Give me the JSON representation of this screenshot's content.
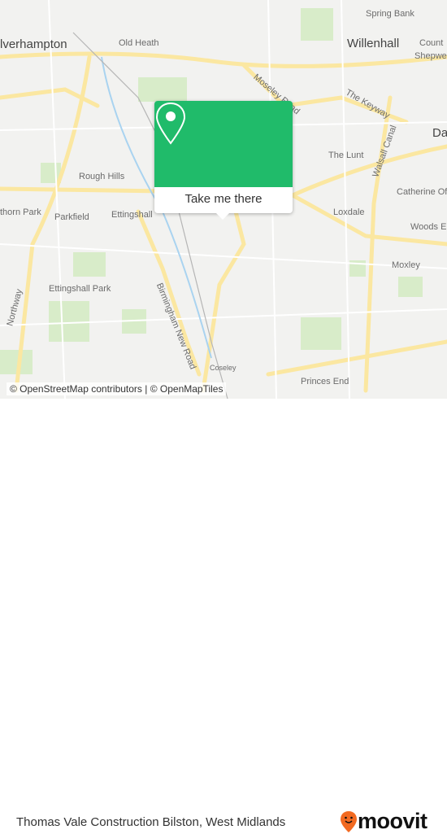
{
  "map": {
    "labels": {
      "wolverhampton": "lverhampton",
      "old_heath": "Old Heath",
      "spring_bank": "Spring Bank",
      "willenhall": "Willenhall",
      "county": "Count",
      "shepwell": "Shepwe",
      "moseley_road": "Moseley Road",
      "the_keyway": "The Keyway",
      "darlaston": "Da",
      "the_lunt": "The Lunt",
      "walsall_canal": "Walsall Canal",
      "rough_hills": "Rough Hills",
      "catherine": "Catherine Of",
      "thorn_park": "thorn Park",
      "parkfield": "Parkfield",
      "ettingshall": "Ettingshall",
      "loxdale": "Loxdale",
      "woods": "Woods E",
      "moxley": "Moxley",
      "ettingshall_park": "Ettingshall Park",
      "birmingham_new_road": "Birmingham New Road",
      "northway": "Northway",
      "coseley": "Coseley",
      "princes_end": "Princes End"
    },
    "attribution": "© OpenStreetMap contributors | © OpenMapTiles"
  },
  "popup": {
    "button_label": "Take me there",
    "icon": "map-pin-icon",
    "color": "#20bb6a"
  },
  "footer": {
    "title": "Thomas Vale Construction Bilston, West Midlands",
    "logo_text": "moovit",
    "logo_color": "#f26a21"
  }
}
